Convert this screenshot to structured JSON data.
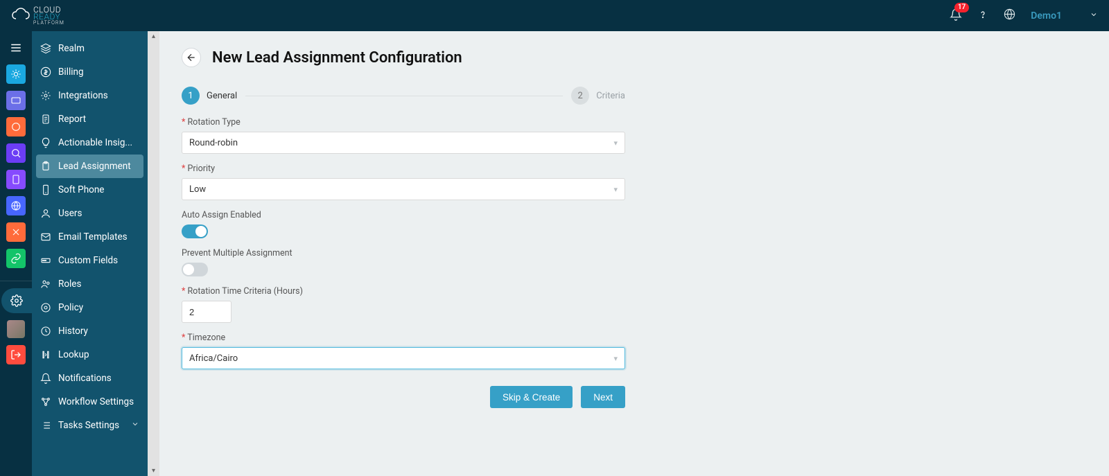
{
  "header": {
    "notification_count": "17",
    "user_name": "Demo1"
  },
  "sidebar": {
    "items": [
      {
        "label": "Realm"
      },
      {
        "label": "Billing"
      },
      {
        "label": "Integrations"
      },
      {
        "label": "Report"
      },
      {
        "label": "Actionable Insig..."
      },
      {
        "label": "Lead Assignment"
      },
      {
        "label": "Soft Phone"
      },
      {
        "label": "Users"
      },
      {
        "label": "Email Templates"
      },
      {
        "label": "Custom Fields"
      },
      {
        "label": "Roles"
      },
      {
        "label": "Policy"
      },
      {
        "label": "History"
      },
      {
        "label": "Lookup"
      },
      {
        "label": "Notifications"
      },
      {
        "label": "Workflow Settings"
      },
      {
        "label": "Tasks Settings"
      }
    ]
  },
  "page": {
    "title": "New Lead Assignment Configuration"
  },
  "stepper": {
    "step1_num": "1",
    "step1_label": "General",
    "step2_num": "2",
    "step2_label": "Criteria"
  },
  "form": {
    "rotation_type_label": "Rotation Type",
    "rotation_type_value": "Round-robin",
    "priority_label": "Priority",
    "priority_value": "Low",
    "auto_assign_label": "Auto Assign Enabled",
    "auto_assign_on": true,
    "prevent_multiple_label": "Prevent Multiple Assignment",
    "prevent_multiple_on": false,
    "rotation_time_label": "Rotation Time Criteria (Hours)",
    "rotation_time_value": "2",
    "timezone_label": "Timezone",
    "timezone_value": "Africa/Cairo"
  },
  "buttons": {
    "skip_create": "Skip & Create",
    "next": "Next"
  }
}
